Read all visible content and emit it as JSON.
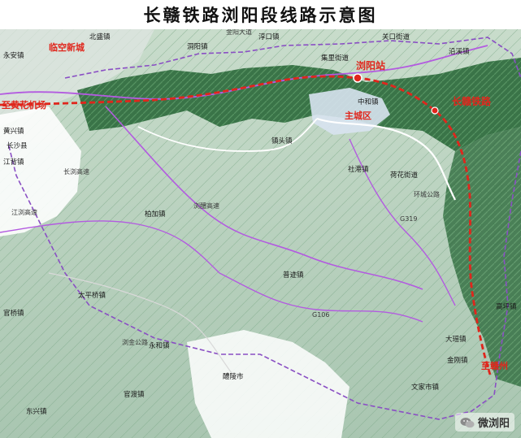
{
  "title": "长赣铁路浏阳段线路示意图",
  "colors": {
    "railway": "#e0261c",
    "county_boundary": "#8a4fc4",
    "highway": "#a64fd4",
    "road": "#ffffff",
    "lowland": "#b9cfc0",
    "mountain": "#2f6a3f",
    "water": "#ffffff"
  },
  "annotations": {
    "railway_name": "长赣铁路",
    "station": "浏阳站",
    "airport": "至黄花机场",
    "ganzhou": "至赣州",
    "urban_area": "主城区",
    "new_area": "临空新城"
  },
  "places": {
    "yongan": "永安镇",
    "beisheng": "北盛镇",
    "jili": "集里街道",
    "guankou": "关口街道",
    "dongyang": "洞阳镇",
    "chunhua": "淳口镇",
    "huanglong": "黄兴镇",
    "changsha": "长沙县",
    "jiangbei": "江背镇",
    "zhenfu": "镇头镇",
    "zhenkui": "柏加镇",
    "hehua": "荷花街道",
    "puji": "普迹镇",
    "guanqiao": "官桥镇",
    "taiping": "太平桥镇",
    "yonghe": "永和镇",
    "gaoping": "高坪镇",
    "dayao": "大瑶镇",
    "jinggang": "金刚镇",
    "wenjiashi": "文家市镇",
    "liling": "醴陵市",
    "dongxing": "东兴镇",
    "guandu": "官渡镇",
    "shegang": "社港镇",
    "zhonghe": "中和镇",
    "yanqi": "沿溪镇"
  },
  "roads": {
    "jiangliu": "江浏高速",
    "changliu": "长浏高速",
    "liuliu": "浏醴高速",
    "g106": "G106",
    "g319": "G319",
    "liujin": "浏金公路",
    "jinyang": "金阳大道",
    "huanxing": "环城公路"
  },
  "watermark": "微浏阳"
}
